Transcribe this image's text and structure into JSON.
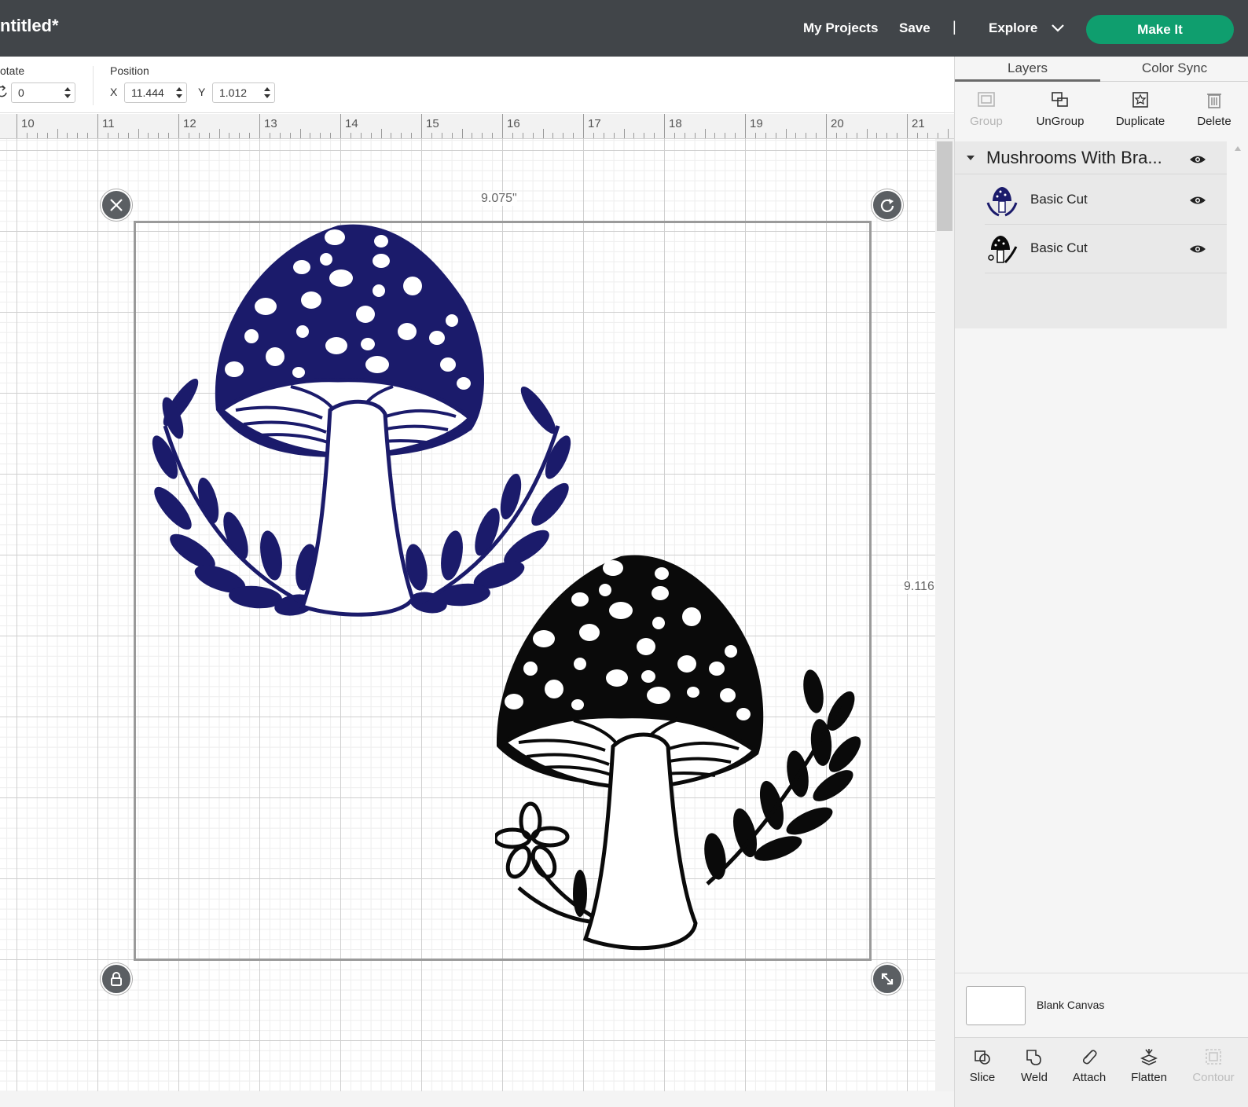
{
  "header": {
    "title": "ntitled*",
    "my_projects": "My Projects",
    "save": "Save",
    "divider": "|",
    "explore": "Explore",
    "make_it": "Make It",
    "make_it_color": "#0f9e6e"
  },
  "toolbar": {
    "rotate_label": "otate",
    "rotate_value": "0",
    "position_label": "Position",
    "x_label": "X",
    "x_value": "11.444",
    "y_label": "Y",
    "y_value": "1.012"
  },
  "ruler": {
    "numbers": [
      "10",
      "11",
      "12",
      "13",
      "14",
      "15",
      "16",
      "17",
      "18",
      "19",
      "20",
      "21"
    ]
  },
  "canvas": {
    "width_label": "9.075\"",
    "height_label": "9.116",
    "blue_mushroom_color": "#1b1b6b",
    "black_mushroom_color": "#0a0a0a"
  },
  "panel": {
    "tabs": [
      "Layers",
      "Color Sync"
    ],
    "actions": [
      "Group",
      "UnGroup",
      "Duplicate",
      "Delete"
    ],
    "group_name": "Mushrooms With Bra...",
    "layers": [
      {
        "name": "Basic Cut",
        "color": "#1b1b6b"
      },
      {
        "name": "Basic Cut",
        "color": "#0a0a0a"
      }
    ],
    "blank_canvas": "Blank Canvas",
    "bottom_actions": [
      "Slice",
      "Weld",
      "Attach",
      "Flatten",
      "Contour"
    ]
  }
}
